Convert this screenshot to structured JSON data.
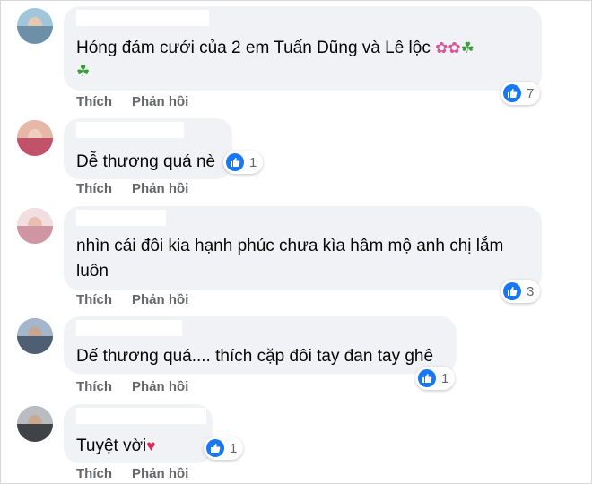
{
  "comments": [
    {
      "text": "Hóng đám cưới của 2 em Tuấn Dũng và Lê lộc",
      "line2": "",
      "reaction_count": "7",
      "actions": {
        "like": "Thích",
        "reply": "Phản hồi"
      }
    },
    {
      "text": "Dễ thương quá nè",
      "reaction_count": "1",
      "actions": {
        "like": "Thích",
        "reply": "Phản hồi"
      }
    },
    {
      "text": "nhìn cái đôi kia hạnh phúc chưa kìa hâm mộ anh chị lắm",
      "line2": "luôn",
      "reaction_count": "3",
      "actions": {
        "like": "Thích",
        "reply": "Phản hồi"
      }
    },
    {
      "text": "Dế thương quá.... thích cặp đôi tay đan tay ghê",
      "reaction_count": "1",
      "actions": {
        "like": "Thích",
        "reply": "Phản hồi"
      }
    },
    {
      "text": "Tuyệt vời",
      "reaction_count": "1",
      "actions": {
        "like": "Thích",
        "reply": "Phản hồi"
      }
    }
  ],
  "icons": {
    "flower": "flower-icon",
    "clover": "four-leaf-clover-icon",
    "heart": "red-heart-icon",
    "like": "like-thumb-icon"
  },
  "colors": {
    "bubble": "#f0f2f5",
    "like_blue": "#1877f2",
    "action_gray": "#65676b",
    "heart_red": "#e0245e"
  }
}
